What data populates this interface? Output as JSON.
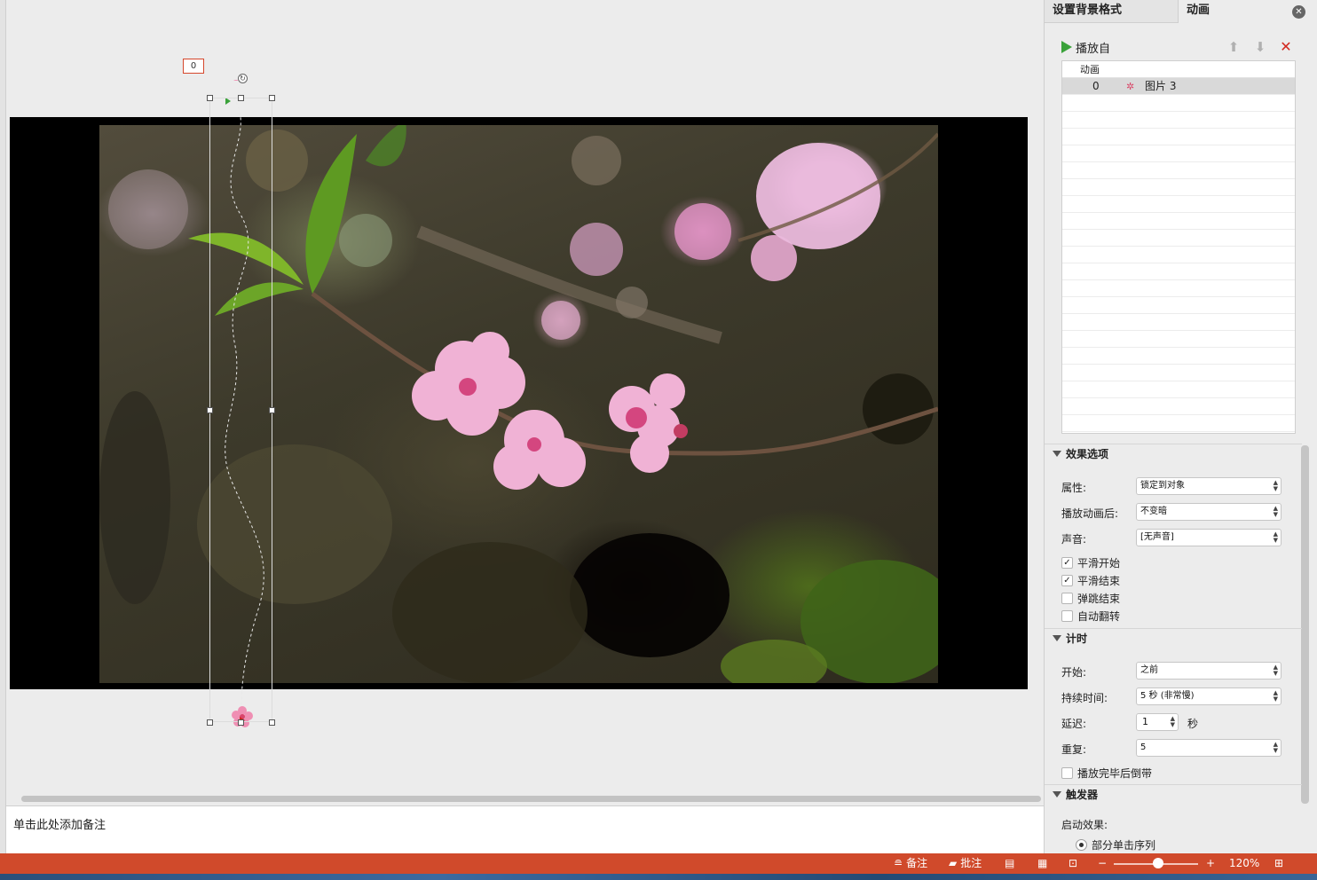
{
  "canvas": {
    "animation_order_badge": "0",
    "notes_placeholder": "单击此处添加备注"
  },
  "pane": {
    "tabs": [
      "设置背景格式",
      "动画"
    ],
    "active_tab": "动画",
    "close_icon": "close-circle-icon",
    "play_from_label": "播放自",
    "move_up_icon": "arrow-up-icon",
    "move_down_icon": "arrow-down-icon",
    "remove_icon": "x-icon",
    "list": {
      "header": "动画",
      "items": [
        {
          "order": "0",
          "icon": "motion-path-effect-icon",
          "name": "图片 3",
          "selected": true
        }
      ]
    },
    "effect_options": {
      "title": "效果选项",
      "property_label": "属性:",
      "property_value": "锁定到对象",
      "after_anim_label": "播放动画后:",
      "after_anim_value": "不变暗",
      "sound_label": "声音:",
      "sound_value": "[无声音]",
      "checkboxes": [
        {
          "label": "平滑开始",
          "checked": true
        },
        {
          "label": "平滑结束",
          "checked": true
        },
        {
          "label": "弹跳结束",
          "checked": false
        },
        {
          "label": "自动翻转",
          "checked": false
        }
      ]
    },
    "timing": {
      "title": "计时",
      "start_label": "开始:",
      "start_value": "之前",
      "duration_label": "持续时间:",
      "duration_value": "5 秒 (非常慢)",
      "delay_label": "延迟:",
      "delay_value": "1",
      "delay_unit": "秒",
      "repeat_label": "重复:",
      "repeat_value": "5",
      "rewind_label": "播放完毕后倒带",
      "rewind_checked": false
    },
    "trigger": {
      "title": "触发器",
      "start_effect_label": "启动效果:",
      "option_label": "部分单击序列"
    }
  },
  "status_bar": {
    "notes_label": "备注",
    "comments_label": "批注",
    "zoom_value": "120%",
    "zoom_level": 0.5,
    "accent_color": "#d04a2b"
  }
}
